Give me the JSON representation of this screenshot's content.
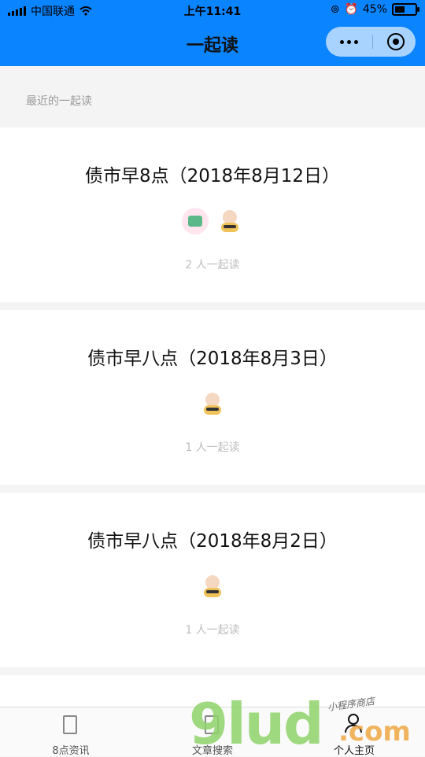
{
  "status_bar": {
    "carrier": "中国联通",
    "time": "上午11:41",
    "battery": "45%"
  },
  "nav": {
    "title": "一起读"
  },
  "section": {
    "label": "最近的一起读"
  },
  "cards": [
    {
      "title": "债市早8点（2018年8月12日）",
      "count": "2 人一起读"
    },
    {
      "title": "债市早八点（2018年8月3日）",
      "count": "1 人一起读"
    },
    {
      "title": "债市早八点（2018年8月2日）",
      "count": "1 人一起读"
    }
  ],
  "tabbar": {
    "tabs": [
      {
        "label": "8点资讯"
      },
      {
        "label": "文章搜索"
      },
      {
        "label": "个人主页"
      }
    ]
  },
  "watermark": {
    "brand": "9lud",
    "domain": ".com",
    "tagline": "小程序商店"
  },
  "colors": {
    "nav_bg": "#0a84ff",
    "capsule_bg": "#a8d2ff"
  }
}
